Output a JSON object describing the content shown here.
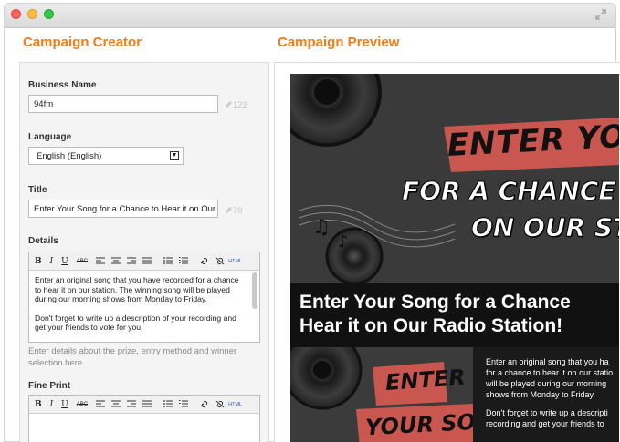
{
  "window": {
    "controls": [
      "close",
      "minimize",
      "maximize"
    ],
    "expand_icon": "expand-icon"
  },
  "creator": {
    "title": "Campaign Creator",
    "business_name": {
      "label": "Business Name",
      "value": "94fm",
      "counter": "122"
    },
    "language": {
      "label": "Language",
      "value": "English (English)"
    },
    "title_field": {
      "label": "Title",
      "value": "Enter Your Song for a Chance to Hear it on Our",
      "counter": "79"
    },
    "details": {
      "label": "Details",
      "toolbar": [
        "B",
        "I",
        "U",
        "ABC",
        "HTML"
      ],
      "paragraphs": [
        "Enter an original song that you have recorded for a chance to hear it on our station. The winning song will be played during our morning shows from Monday to Friday.",
        "Don't forget to write up a description of your recording and get your friends to vote for you."
      ],
      "hint": "Enter details about the prize, entry method and winner selection here."
    },
    "fine_print": {
      "label": "Fine Print",
      "toolbar": [
        "B",
        "I",
        "U",
        "ABC",
        "HTML"
      ]
    }
  },
  "preview": {
    "title": "Campaign Preview",
    "hero_line1": "ENTER YOU",
    "hero_line2": "FOR A CHANCE T",
    "hero_line3": "ON OUR STA",
    "banner_line1": "Enter Your Song for a Chance",
    "banner_line2": "Hear it on Our Radio Station!",
    "thumb_line1": "ENTER",
    "thumb_line2": "YOUR SONG",
    "text_lines_1": [
      "Enter an original song that you ha",
      "for a chance to hear it on our statio",
      "will be played during our morning",
      "shows from Monday to Friday."
    ],
    "text_lines_2": [
      "Don't forget to write up a descripti",
      "recording and get your friends to"
    ]
  },
  "colors": {
    "accent": "#f07d1a",
    "banner_bg": "#111111",
    "stamp_red": "#d9534f"
  }
}
